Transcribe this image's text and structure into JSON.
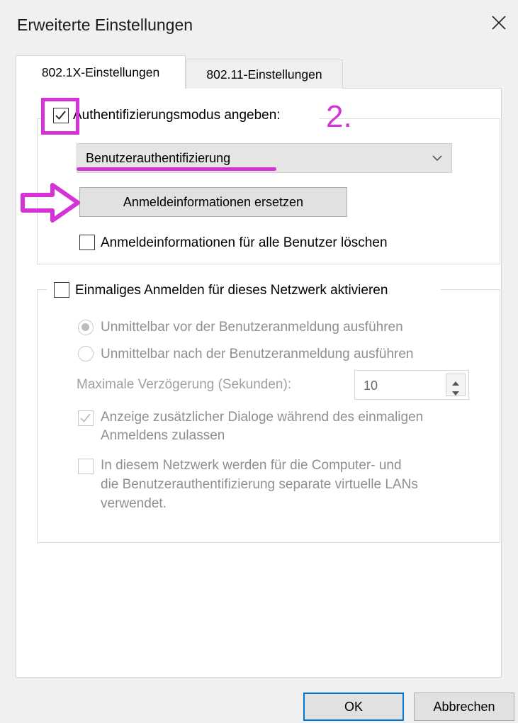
{
  "window": {
    "title": "Erweiterte Einstellungen",
    "close_icon": "close-icon"
  },
  "tabs": [
    {
      "label": "802.1X-Einstellungen",
      "active": true
    },
    {
      "label": "802.11-Einstellungen",
      "active": false
    }
  ],
  "auth_section": {
    "specify_mode": {
      "label": "Authentifizierungsmodus angeben:",
      "checked": true
    },
    "mode_select": {
      "value": "Benutzerauthentifizierung",
      "icon": "chevron-down-icon"
    },
    "replace_credentials_button": "Anmeldeinformationen ersetzen",
    "delete_all_credentials": {
      "label": "Anmeldeinformationen für alle Benutzer löschen",
      "checked": false
    }
  },
  "sso_section": {
    "enable_sso": {
      "label": "Einmaliges Anmelden für dieses Netzwerk aktivieren",
      "checked": false
    },
    "radio_before": {
      "label": "Unmittelbar vor der Benutzeranmeldung ausführen",
      "selected": true,
      "enabled": false
    },
    "radio_after": {
      "label": "Unmittelbar nach der Benutzeranmeldung ausführen",
      "selected": false,
      "enabled": false
    },
    "max_delay": {
      "label": "Maximale Verzögerung (Sekunden):",
      "value": "10"
    },
    "allow_dialogs": {
      "label_line1": "Anzeige zusätzlicher Dialoge während des einmaligen",
      "label_line2": "Anmeldens zulassen",
      "checked": true,
      "enabled": false
    },
    "separate_vlans": {
      "label_line1": "In diesem Netzwerk werden für die Computer- und",
      "label_line2": "die Benutzerauthentifizierung separate virtuelle LANs",
      "label_line3": "verwendet.",
      "checked": false,
      "enabled": false
    }
  },
  "annotations": {
    "step_number": "2.",
    "color": "#d633d6"
  },
  "footer": {
    "ok_label": "OK",
    "cancel_label": "Abbrechen"
  },
  "colors": {
    "accent_focus": "#0078d7",
    "disabled_text": "#8f8f8f",
    "background": "#f0f0f0"
  }
}
